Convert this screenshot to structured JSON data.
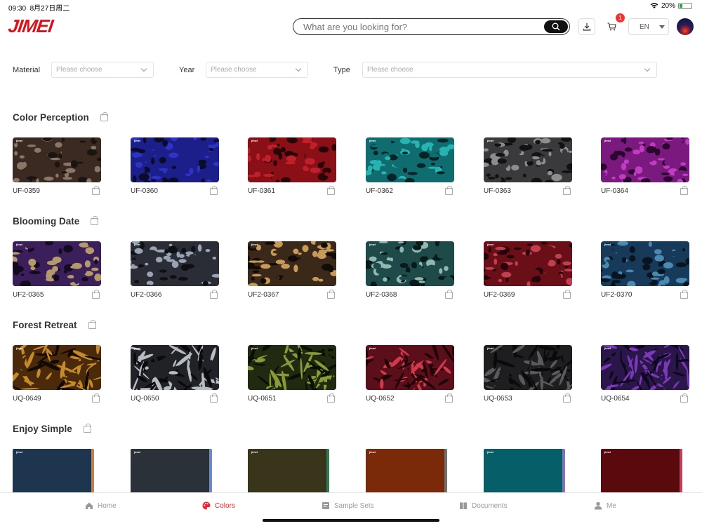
{
  "status": {
    "time": "09:30",
    "date": "8月27日周二",
    "battery": "20%"
  },
  "header": {
    "logo": "JIMEI",
    "search_placeholder": "What are you looking for?",
    "cart_count": "1",
    "language": "EN"
  },
  "filters": [
    {
      "label": "Material",
      "placeholder": "Please choose"
    },
    {
      "label": "Year",
      "placeholder": "Please choose"
    },
    {
      "label": "Type",
      "placeholder": "Please choose"
    }
  ],
  "sections": [
    {
      "title": "Color Perception",
      "items": [
        {
          "code": "UF-0359",
          "colors": [
            "#3b2a22",
            "#8a7566",
            "#1a1412"
          ]
        },
        {
          "code": "UF-0360",
          "colors": [
            "#1c1f8a",
            "#2d33c4",
            "#0b0b2a"
          ]
        },
        {
          "code": "UF-0361",
          "colors": [
            "#8a0f17",
            "#c0202a",
            "#2a0508"
          ]
        },
        {
          "code": "UF-0362",
          "colors": [
            "#0f6d70",
            "#27b3b0",
            "#062427"
          ]
        },
        {
          "code": "UF-0363",
          "colors": [
            "#3a3a3d",
            "#8d8d90",
            "#121214"
          ]
        },
        {
          "code": "UF-0364",
          "colors": [
            "#7a1a7e",
            "#c13bc4",
            "#2b0730"
          ]
        }
      ]
    },
    {
      "title": "Blooming Date",
      "items": [
        {
          "code": "UF2-0365",
          "colors": [
            "#3a1f5a",
            "#b49a6a",
            "#140a22"
          ]
        },
        {
          "code": "UF2-0366",
          "colors": [
            "#2a2d35",
            "#9aa3b3",
            "#0f1014"
          ]
        },
        {
          "code": "UF2-0367",
          "colors": [
            "#3a2818",
            "#c89a5a",
            "#120c08"
          ]
        },
        {
          "code": "UF2-0368",
          "colors": [
            "#1f4a4a",
            "#8fb8b0",
            "#0a1a1a"
          ]
        },
        {
          "code": "UF2-0369",
          "colors": [
            "#6a0f18",
            "#c04050",
            "#25050a"
          ]
        },
        {
          "code": "UF2-0370",
          "colors": [
            "#173a5a",
            "#4a8ab0",
            "#081420"
          ]
        }
      ]
    },
    {
      "title": "Forest Retreat",
      "items": [
        {
          "code": "UQ-0649",
          "colors": [
            "#4a2a0a",
            "#c58a2a",
            "#120a04"
          ]
        },
        {
          "code": "UQ-0650",
          "colors": [
            "#202226",
            "#b8bcc4",
            "#0a0a0c"
          ]
        },
        {
          "code": "UQ-0651",
          "colors": [
            "#1f2a10",
            "#8a9a3a",
            "#0a0f05"
          ]
        },
        {
          "code": "UQ-0652",
          "colors": [
            "#5a0f1a",
            "#d03a4a",
            "#200508"
          ]
        },
        {
          "code": "UQ-0653",
          "colors": [
            "#1e1e20",
            "#5a5a5e",
            "#0a0a0b"
          ]
        },
        {
          "code": "UQ-0654",
          "colors": [
            "#2a1648",
            "#7a3ab8",
            "#0e0720"
          ]
        }
      ]
    },
    {
      "title": "Enjoy Simple",
      "items": [
        {
          "code": "",
          "colors": [
            "#1e3550",
            "#c08050"
          ]
        },
        {
          "code": "",
          "colors": [
            "#2a3138",
            "#6a8ac8"
          ]
        },
        {
          "code": "",
          "colors": [
            "#38351a",
            "#2f7a55"
          ]
        },
        {
          "code": "",
          "colors": [
            "#7a2a08",
            "#707070"
          ]
        },
        {
          "code": "",
          "colors": [
            "#065e68",
            "#8a70b8"
          ]
        },
        {
          "code": "",
          "colors": [
            "#5a0a0c",
            "#c04060"
          ]
        }
      ]
    }
  ],
  "tabs": [
    {
      "label": "Home",
      "icon": "home-icon",
      "active": false
    },
    {
      "label": "Colors",
      "icon": "palette-icon",
      "active": true
    },
    {
      "label": "Sample Sets",
      "icon": "sample-sets-icon",
      "active": false
    },
    {
      "label": "Documents",
      "icon": "documents-icon",
      "active": false
    },
    {
      "label": "Me",
      "icon": "user-icon",
      "active": false
    }
  ],
  "colors": {
    "accent": "#e8262f",
    "brand": "#d8121a"
  }
}
